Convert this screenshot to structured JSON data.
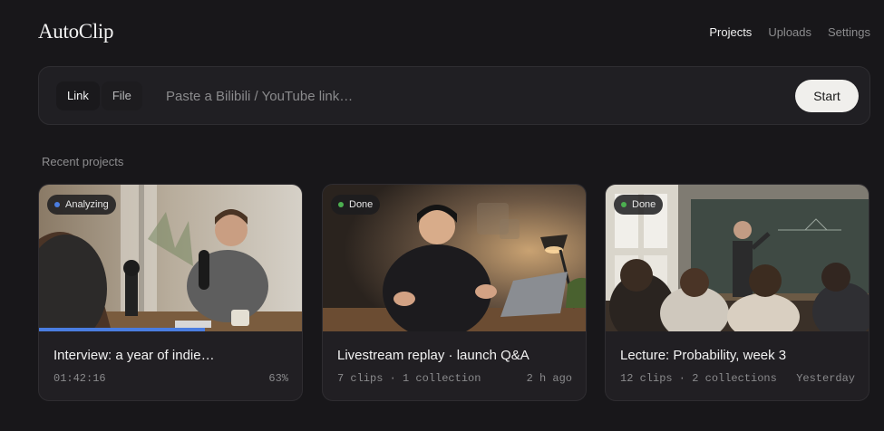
{
  "app": {
    "logo": "AutoClip"
  },
  "nav": {
    "projects": "Projects",
    "uploads": "Uploads",
    "settings": "Settings"
  },
  "input_bar": {
    "tab_link": "Link",
    "tab_file": "File",
    "placeholder": "Paste a Bilibili / YouTube link…",
    "start_label": "Start"
  },
  "section_title": "Recent projects",
  "colors": {
    "analyzing": "#4a7de0",
    "done": "#4caf50",
    "accent_button": "#f0efec"
  },
  "projects": [
    {
      "status": "Analyzing",
      "title": "Interview: a year of indie…",
      "meta": "01:42:16",
      "right": "63%",
      "progress": 0.63
    },
    {
      "status": "Done",
      "title": "Livestream replay · launch Q&A",
      "meta": "7 clips · 1 collection",
      "right": "2 h ago"
    },
    {
      "status": "Done",
      "title": "Lecture: Probability, week 3",
      "meta": "12 clips · 2 collections",
      "right": "Yesterday"
    }
  ]
}
